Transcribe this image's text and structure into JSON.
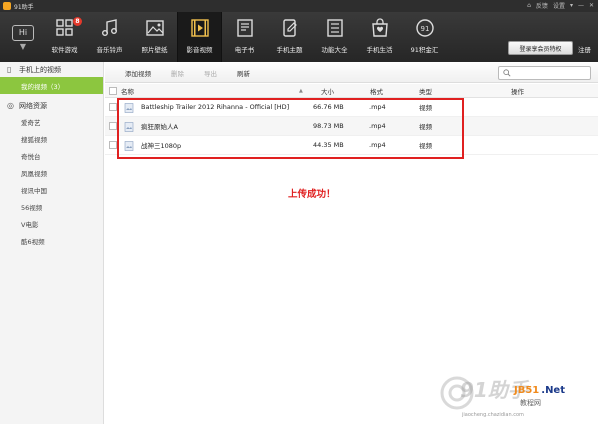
{
  "titlebar": {
    "app_title": "91助手",
    "links": [
      "反馈",
      "设置"
    ]
  },
  "toolbar": {
    "items": [
      {
        "label": "软件游戏",
        "icon": "apps-grid-icon",
        "badge": "8"
      },
      {
        "label": "音乐铃声",
        "icon": "music-note-icon"
      },
      {
        "label": "照片壁纸",
        "icon": "picture-icon"
      },
      {
        "label": "影音视频",
        "icon": "video-play-icon",
        "active": true
      },
      {
        "label": "电子书",
        "icon": "book-icon"
      },
      {
        "label": "手机主题",
        "icon": "phone-theme-icon"
      },
      {
        "label": "功能大全",
        "icon": "function-list-icon"
      },
      {
        "label": "手机生活",
        "icon": "shopping-bag-icon"
      },
      {
        "label": "91积金汇",
        "icon": "coin-icon"
      }
    ],
    "home_label": "Hi",
    "login_label": "登录享会员特权",
    "register_label": "注册"
  },
  "sidebar": {
    "section1": "手机上的视频",
    "my_videos": "我的视频（3）",
    "section2": "网络资源",
    "items": [
      "爱奇艺",
      "搜狐视频",
      "奇悦台",
      "凤凰视频",
      "视讯中国",
      "56视频",
      "V电影",
      "酷6视频"
    ]
  },
  "subbar": {
    "add": "添加视频",
    "delete": "删除",
    "export": "导出",
    "refresh": "刷新",
    "search_placeholder": ""
  },
  "table": {
    "headers": {
      "name": "名称",
      "size": "大小",
      "format": "格式",
      "type": "类型",
      "op": "操作"
    },
    "rows": [
      {
        "name": "Battleship Trailer 2012 Rihanna - Official [HD]",
        "size": "66.76 MB",
        "format": ".mp4",
        "type": "视频"
      },
      {
        "name": "疯狂原始人A",
        "size": "98.73 MB",
        "format": ".mp4",
        "type": "视频"
      },
      {
        "name": "战神三1080p",
        "size": "44.35 MB",
        "format": ".mp4",
        "type": "视频"
      }
    ]
  },
  "status": {
    "message": "上传成功！"
  },
  "watermark": {
    "jb": "JB51",
    "net": ".Net",
    "cn": "教程网",
    "url": "jiaocheng.chazidian.com",
    "big": "91助手"
  },
  "colors": {
    "accent_green": "#8cc63f",
    "highlight_red": "#e02020",
    "toolbar_bg": "#2a2a2a"
  }
}
